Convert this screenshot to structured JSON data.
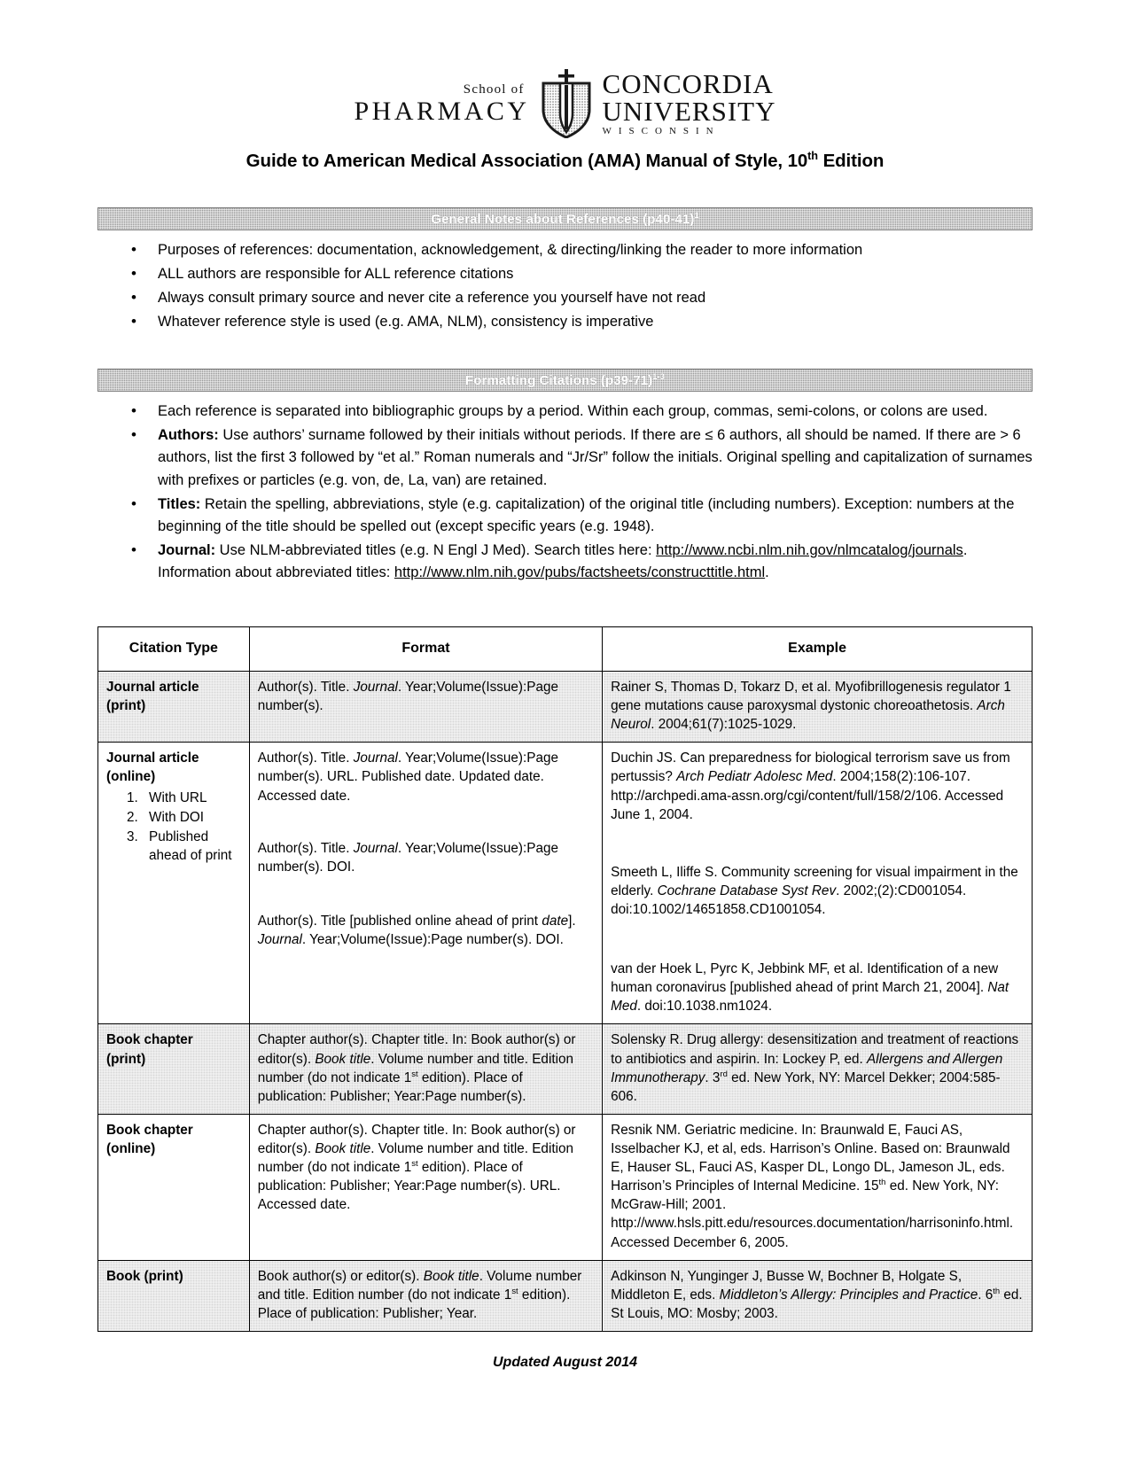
{
  "logo": {
    "school_of": "School of",
    "pharmacy": "PHARMACY",
    "concordia": "CONCORDIA",
    "university": "UNIVERSITY",
    "wisconsin": "WISCONSIN",
    "crest_icon": "shield-crest-icon"
  },
  "title": {
    "main": "Guide to American Medical Association (AMA) Manual of Style, 10",
    "sup": "th",
    "tail": " Edition"
  },
  "sections": [
    {
      "id": "general-notes",
      "heading": "General Notes about References (p40-41)",
      "heading_sup": "1",
      "bullets": [
        "Purposes of references: documentation, acknowledgement, & directing/linking the reader to more information",
        "ALL authors are responsible for ALL reference citations",
        "Always consult primary source and never cite a reference you yourself have not read",
        "Whatever reference style is used (e.g. AMA, NLM), consistency is imperative"
      ]
    },
    {
      "id": "formatting-citations",
      "heading": "Formatting Citations (p39-71)",
      "heading_sup": "1-3",
      "bullets": [
        {
          "label": "",
          "text": "Each reference is separated into bibliographic groups by a period. Within each group, commas, semi-colons, or colons are used."
        },
        {
          "label": "Authors:",
          "text": " Use authors’ surname followed by their initials without periods. If there are ≤ 6 authors, all should be named. If there are > 6 authors, list the first 3 followed by “et al.” Roman numerals and “Jr/Sr” follow the initials. Original spelling and capitalization of surnames with prefixes or particles (e.g. von, de, La, van) are retained."
        },
        {
          "label": "Titles:",
          "text": " Retain the spelling, abbreviations, style (e.g. capitalization) of the original title (including numbers). Exception: numbers at the beginning of the title should be spelled out (except specific years (e.g. 1948)."
        },
        {
          "label": "Journal:",
          "text": " Use NLM-abbreviated titles (e.g. N Engl J Med). Search titles here: ",
          "link1": "http://www.ncbi.nlm.nih.gov/nlmcatalog/journals",
          "text2": ". Information about abbreviated titles: ",
          "link2": "http://www.nlm.nih.gov/pubs/factsheets/constructtitle.html",
          "text3": "."
        }
      ]
    }
  ],
  "table": {
    "headers": [
      "Citation Type",
      "Format",
      "Example"
    ],
    "rows": [
      {
        "shaded": true,
        "type_lines": [
          "Journal article",
          "(print)"
        ],
        "format": "Author(s). Title. <i>Journal</i>. Year;Volume(Issue):Page number(s).",
        "example": "Rainer S, Thomas D, Tokarz D, et al. Myofibrillogenesis regulator 1 gene mutations cause paroxysmal dystonic choreoathetosis. <i>Arch Neurol</i>. 2004;61(7):1025-1029."
      },
      {
        "shaded": false,
        "type_lines": [
          "Journal article",
          "(online)"
        ],
        "sub_items": [
          "With URL",
          "With DOI",
          "Published ahead of print"
        ],
        "format_blocks": [
          "Author(s). Title. <i>Journal</i>. Year;Volume(Issue):Page number(s). URL. Published date. Updated date. Accessed date.",
          "Author(s). Title. <i>Journal</i>. Year;Volume(Issue):Page number(s). DOI.",
          "Author(s). Title [published online ahead of print <i>date</i>]. <i>Journal</i>. Year;Volume(Issue):Page number(s). DOI."
        ],
        "example_blocks": [
          "Duchin JS. Can preparedness for biological terrorism save us from pertussis? <i>Arch Pediatr Adolesc Med</i>. 2004;158(2):106-107. http://archpedi.ama-assn.org/cgi/content/full/158/2/106. Accessed June 1, 2004.",
          "Smeeth L, Iliffe S. Community screening for visual impairment in the elderly. <i>Cochrane Database Syst Rev</i>. 2002;(2):CD001054. doi:10.1002/14651858.CD1001054.",
          "van der Hoek L, Pyrc K, Jebbink MF, et al. Identification of a new human coronavirus [published ahead of print March 21, 2004]. <i>Nat Med</i>. doi:10.1038.nm1024."
        ]
      },
      {
        "shaded": true,
        "type_lines": [
          "Book chapter",
          "(print)"
        ],
        "format": "Chapter author(s). Chapter title. In: Book author(s) or editor(s). <i>Book title</i>. Volume number and title. Edition number (do not indicate 1<sup>st</sup> edition). Place of publication: Publisher; Year:Page number(s).",
        "example": "Solensky R. Drug allergy: desensitization and treatment of reactions to antibiotics and aspirin. In: Lockey P, ed. <i>Allergens and Allergen Immunotherapy</i>. 3<sup>rd</sup> ed. New York, NY: Marcel Dekker; 2004:585-606."
      },
      {
        "shaded": false,
        "type_lines": [
          "Book chapter",
          "(online)"
        ],
        "format": "Chapter author(s). Chapter title. In: Book author(s) or editor(s). <i>Book title</i>. Volume number and title. Edition number (do not indicate 1<sup>st</sup> edition). Place of publication: Publisher; Year:Page number(s). URL. Accessed date.",
        "example": "Resnik NM. Geriatric medicine. In: Braunwald E, Fauci AS, Isselbacher KJ, et al, eds. Harrison’s Online. Based on: Braunwald E, Hauser SL, Fauci AS, Kasper DL, Longo DL, Jameson JL, eds. Harrison’s Principles of Internal Medicine. 15<sup>th</sup> ed. New York, NY: McGraw-Hill; 2001. http://www.hsls.pitt.edu/resources.documentation/harrisoninfo.html. Accessed December 6, 2005."
      },
      {
        "shaded": true,
        "type_lines": [
          "Book (print)"
        ],
        "format": "Book author(s) or editor(s). <i>Book title</i>. Volume number and title. Edition number (do not indicate 1<sup>st</sup> edition). Place of publication: Publisher; Year.",
        "example": "Adkinson N, Yunginger J, Busse W, Bochner B, Holgate S, Middleton E, eds. <i>Middleton’s Allergy: Principles and Practice</i>. 6<sup>th</sup> ed. St Louis, MO: Mosby; 2003."
      }
    ]
  },
  "footer": {
    "updated": "Updated August 2014"
  }
}
